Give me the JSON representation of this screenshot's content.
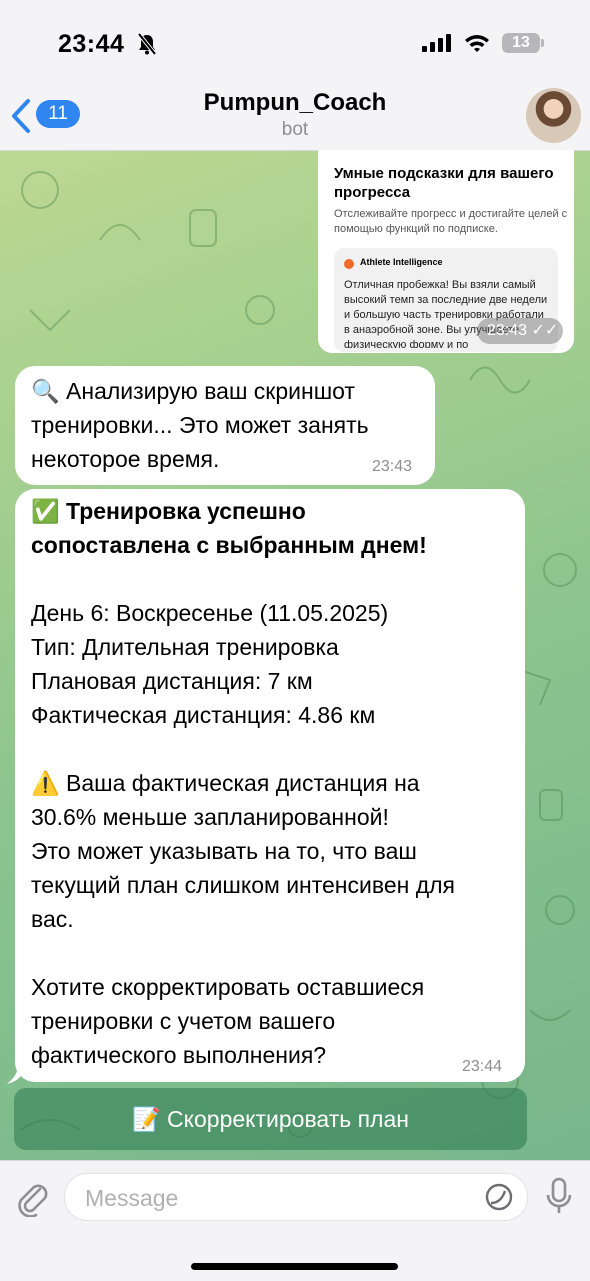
{
  "status_bar": {
    "time": "23:44",
    "battery": "13"
  },
  "header": {
    "back_count": "11",
    "title": "Pumpun_Coach",
    "subtitle": "bot"
  },
  "image_message": {
    "title": "Умные подсказки для вашего прогресса",
    "subtitle": "Отслеживайте прогресс и достигайте целей с помощью функций по подписке.",
    "card_name": "Athlete Intelligence",
    "card_text": "Отличная пробежка! Вы взяли самый высокий темп за последние две недели и большую часть тренировки работали в анаэробной зоне. Вы улучшаете физическую форму и по",
    "time": "23:43"
  },
  "messages": [
    {
      "text": "🔍 Анализирую ваш скриншот\nтренировки... Это может занять\nнекоторое время.",
      "time": "23:43"
    },
    {
      "bold": "✅ Тренировка успешно\nсопоставлена с выбранным днем!",
      "text": "\n\nДень 6: Воскресенье (11.05.2025)\nТип: Длительная тренировка\nПлановая дистанция: 7 км\nФактическая дистанция: 4.86 км\n\n⚠️ Ваша фактическая дистанция на\n30.6% меньше запланированной!\nЭто может указывать на то, что ваш\nтекущий план слишком интенсивен для\nвас.\n\nХотите скорректировать оставшиеся\nтренировки с учетом вашего\nфактического выполнения?",
      "time": "23:44"
    }
  ],
  "keyboard": {
    "button_label": "📝 Скорректировать план"
  },
  "input": {
    "placeholder": "Message"
  },
  "colors": {
    "accent": "#2f86f0",
    "bubble": "#ffffff",
    "button": "#4f8f69"
  },
  "icons": [
    "bell-slash-icon",
    "signal-icon",
    "wifi-icon",
    "battery-icon",
    "back-chevron-icon",
    "paperclip-icon",
    "sticker-icon",
    "microphone-icon"
  ]
}
